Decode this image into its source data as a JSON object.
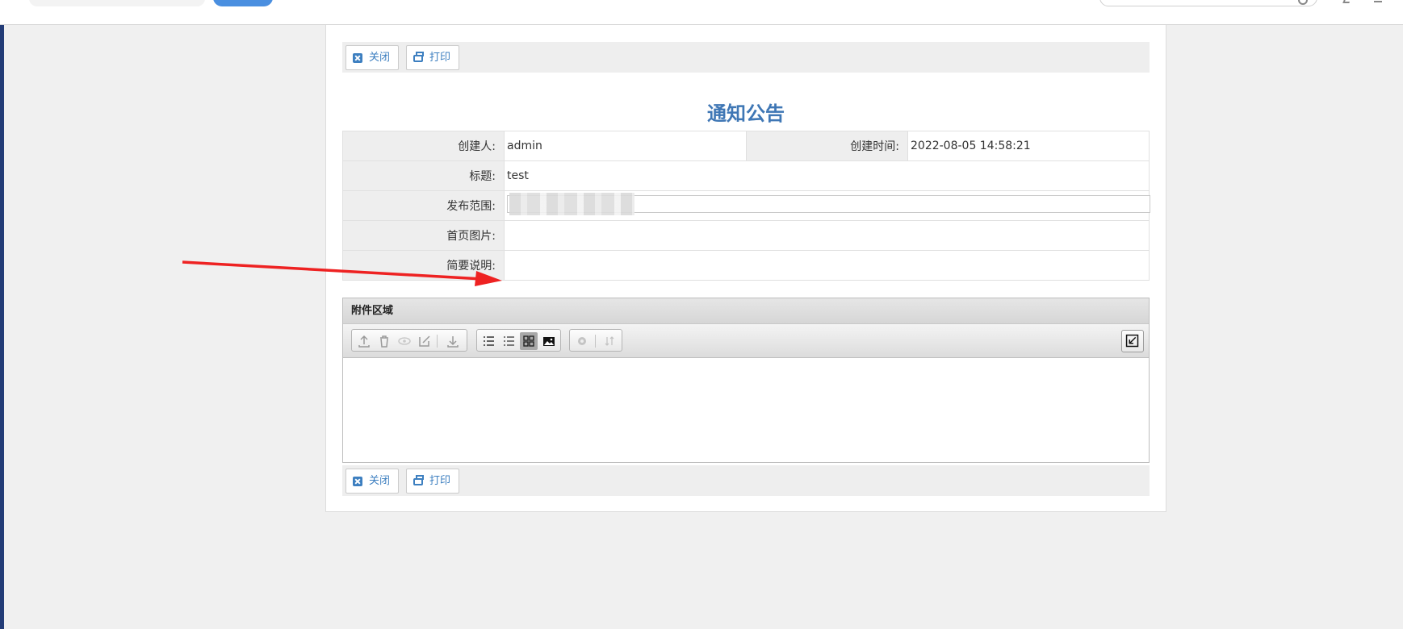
{
  "toolbar": {
    "close_label": "关闭",
    "print_label": "打印"
  },
  "page": {
    "title": "通知公告"
  },
  "form": {
    "creator_label": "创建人:",
    "creator_value": "admin",
    "created_time_label": "创建时间:",
    "created_time_value": "2022-08-05 14:58:21",
    "subject_label": "标题:",
    "subject_value": "test",
    "scope_label": "发布范围:",
    "scope_value": "",
    "homepage_image_label": "首页图片:",
    "summary_label": "简要说明:"
  },
  "attachment": {
    "title": "附件区域"
  },
  "colors": {
    "accent": "#3f77b5",
    "annotation_arrow": "#ee2222"
  }
}
